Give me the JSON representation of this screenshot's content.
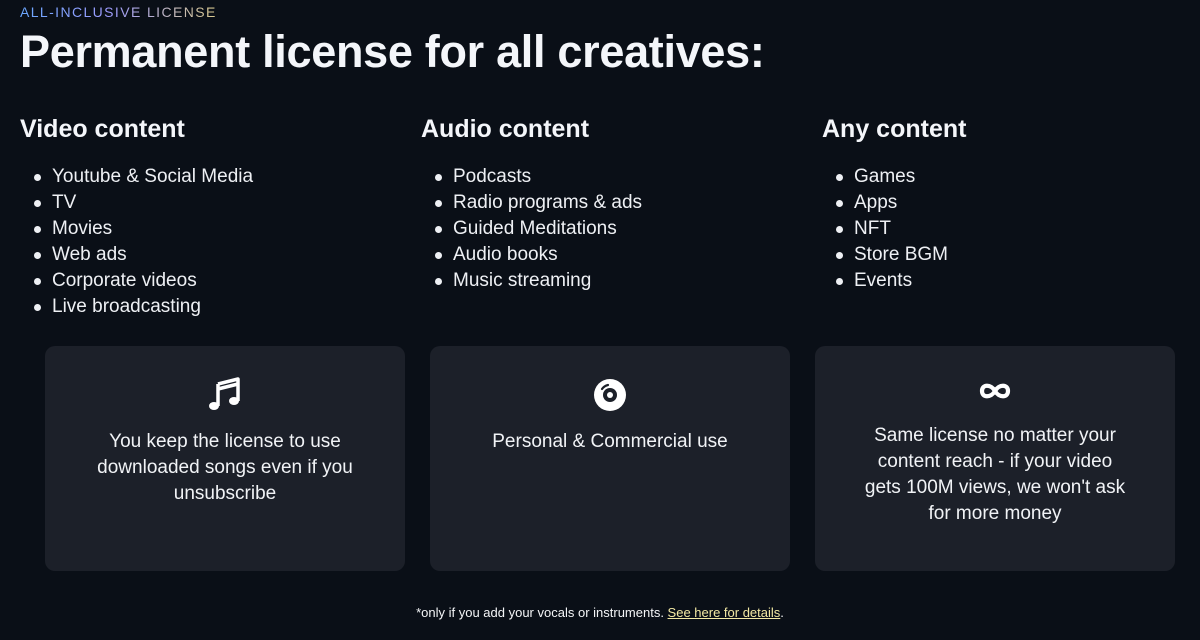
{
  "eyebrow": "ALL-INCLUSIVE LICENSE",
  "title": "Permanent license for all creatives:",
  "columns": [
    {
      "heading": "Video content",
      "items": [
        "Youtube & Social Media",
        "TV",
        "Movies",
        "Web ads",
        "Corporate videos",
        "Live broadcasting"
      ]
    },
    {
      "heading": "Audio content",
      "items": [
        "Podcasts",
        "Radio programs & ads",
        "Guided Meditations",
        "Audio books",
        "Music streaming"
      ]
    },
    {
      "heading": "Any content",
      "items": [
        "Games",
        "Apps",
        "NFT",
        "Store BGM",
        "Events"
      ]
    }
  ],
  "cards": [
    {
      "icon": "music-note-icon",
      "lines": [
        "You keep the license to use",
        "downloaded songs even if you",
        "unsubscribe"
      ]
    },
    {
      "icon": "disc-icon",
      "lines": [
        "Personal & Commercial use"
      ]
    },
    {
      "icon": "infinity-icon",
      "lines": [
        "Same license no matter your",
        "content reach - if your video",
        "gets 100M views, we won't ask",
        "for more money"
      ]
    }
  ],
  "footnote": {
    "text": "*only if you add your vocals or instruments. ",
    "link": "See here for details",
    "end": "."
  },
  "colors": {
    "background": "#0a0f17",
    "card": "#1c2029",
    "link": "#f3e9a4"
  }
}
